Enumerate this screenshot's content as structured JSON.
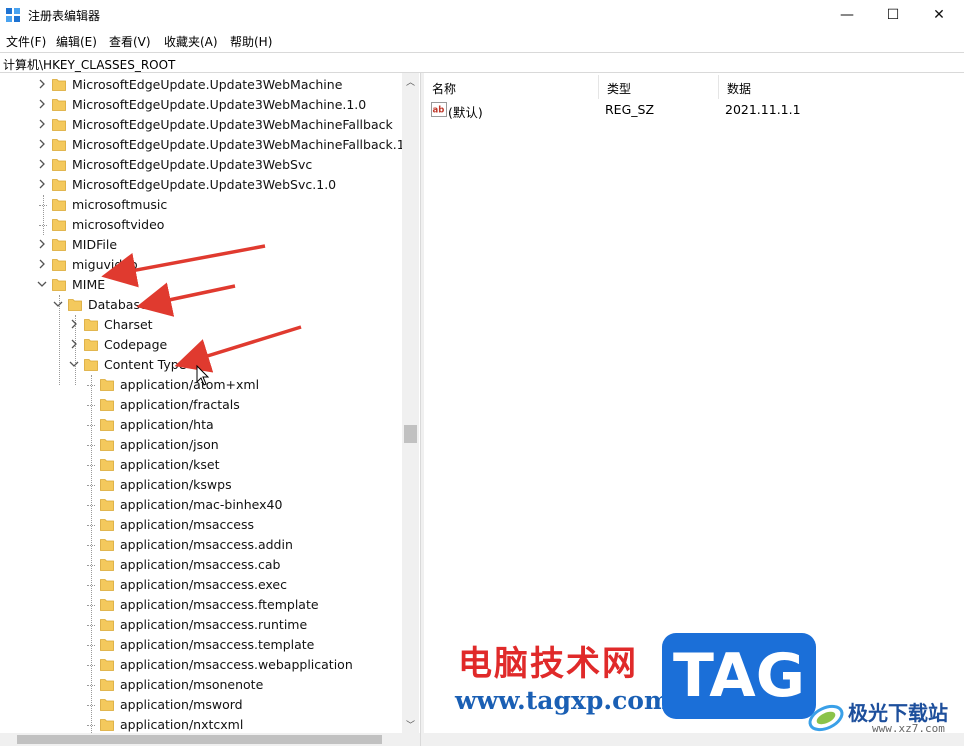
{
  "window": {
    "title": "注册表编辑器",
    "minimize_glyph": "—",
    "maximize_glyph": "☐",
    "close_glyph": "✕"
  },
  "menu": [
    "文件(F)",
    "编辑(E)",
    "查看(V)",
    "收藏夹(A)",
    "帮助(H)"
  ],
  "address": "计算机\\HKEY_CLASSES_ROOT",
  "tree": {
    "items": [
      {
        "label": "MicrosoftEdgeUpdate.Update3WebMachine"
      },
      {
        "label": "MicrosoftEdgeUpdate.Update3WebMachine.1.0"
      },
      {
        "label": "MicrosoftEdgeUpdate.Update3WebMachineFallback"
      },
      {
        "label": "MicrosoftEdgeUpdate.Update3WebMachineFallback.1.0"
      },
      {
        "label": "MicrosoftEdgeUpdate.Update3WebSvc"
      },
      {
        "label": "MicrosoftEdgeUpdate.Update3WebSvc.1.0"
      },
      {
        "label": "microsoftmusic"
      },
      {
        "label": "microsoftvideo"
      },
      {
        "label": "MIDFile"
      },
      {
        "label": "miguvideo"
      },
      {
        "label": "MIME"
      },
      {
        "label": "Database"
      },
      {
        "label": "Charset"
      },
      {
        "label": "Codepage"
      },
      {
        "label": "Content Type"
      },
      {
        "label": "application/atom+xml"
      },
      {
        "label": "application/fractals"
      },
      {
        "label": "application/hta"
      },
      {
        "label": "application/json"
      },
      {
        "label": "application/kset"
      },
      {
        "label": "application/kswps"
      },
      {
        "label": "application/mac-binhex40"
      },
      {
        "label": "application/msaccess"
      },
      {
        "label": "application/msaccess.addin"
      },
      {
        "label": "application/msaccess.cab"
      },
      {
        "label": "application/msaccess.exec"
      },
      {
        "label": "application/msaccess.ftemplate"
      },
      {
        "label": "application/msaccess.runtime"
      },
      {
        "label": "application/msaccess.template"
      },
      {
        "label": "application/msaccess.webapplication"
      },
      {
        "label": "application/msonenote"
      },
      {
        "label": "application/msword"
      },
      {
        "label": "application/nxtcxml"
      }
    ]
  },
  "list": {
    "columns": [
      "名称",
      "类型",
      "数据"
    ],
    "rows": [
      {
        "name": "(默认)",
        "type": "REG_SZ",
        "data": "2021.11.1.1"
      }
    ]
  },
  "watermark": {
    "cn_text": "电脑技术网",
    "url": "www.tagxp.com",
    "tag": "TAG",
    "site_name": "极光下载站",
    "site_url": "www.xz7.com"
  },
  "colors": {
    "folder": "#f4c95d",
    "arrow": "#e03a2f",
    "tag_blue": "#1b6fd8"
  }
}
